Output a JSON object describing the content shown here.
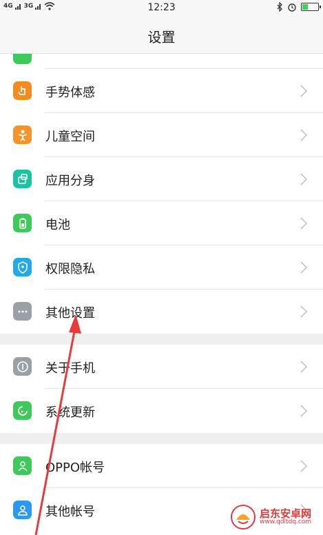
{
  "status_bar": {
    "sim1": "4G",
    "sim2": "3G",
    "time": "12:23",
    "battery_level": 0.35
  },
  "header": {
    "title": "设置"
  },
  "items": [
    {
      "label": "手势体感",
      "icon": "hand-gesture-icon",
      "color": "#f58a1f"
    },
    {
      "label": "儿童空间",
      "icon": "child-icon",
      "color": "#f5932c"
    },
    {
      "label": "应用分身",
      "icon": "app-clone-icon",
      "color": "#1dc3a0"
    },
    {
      "label": "电池",
      "icon": "battery-icon",
      "color": "#3fc95b"
    },
    {
      "label": "权限隐私",
      "icon": "privacy-shield-icon",
      "color": "#21a9e8"
    },
    {
      "label": "其他设置",
      "icon": "more-dots-icon",
      "color": "#9aa0a6"
    }
  ],
  "section2": [
    {
      "label": "关于手机",
      "icon": "info-icon",
      "color": "#9aa0a6"
    },
    {
      "label": "系统更新",
      "icon": "system-update-icon",
      "color": "#3fc95b"
    }
  ],
  "section3": [
    {
      "label": "OPPO帐号",
      "icon": "account-icon",
      "color": "#3fc95b"
    },
    {
      "label": "其他帐号",
      "icon": "other-account-icon",
      "color": "#2a9af0"
    }
  ],
  "watermark": {
    "cn": "启东安卓网",
    "url": "www.qdltdq.com"
  }
}
